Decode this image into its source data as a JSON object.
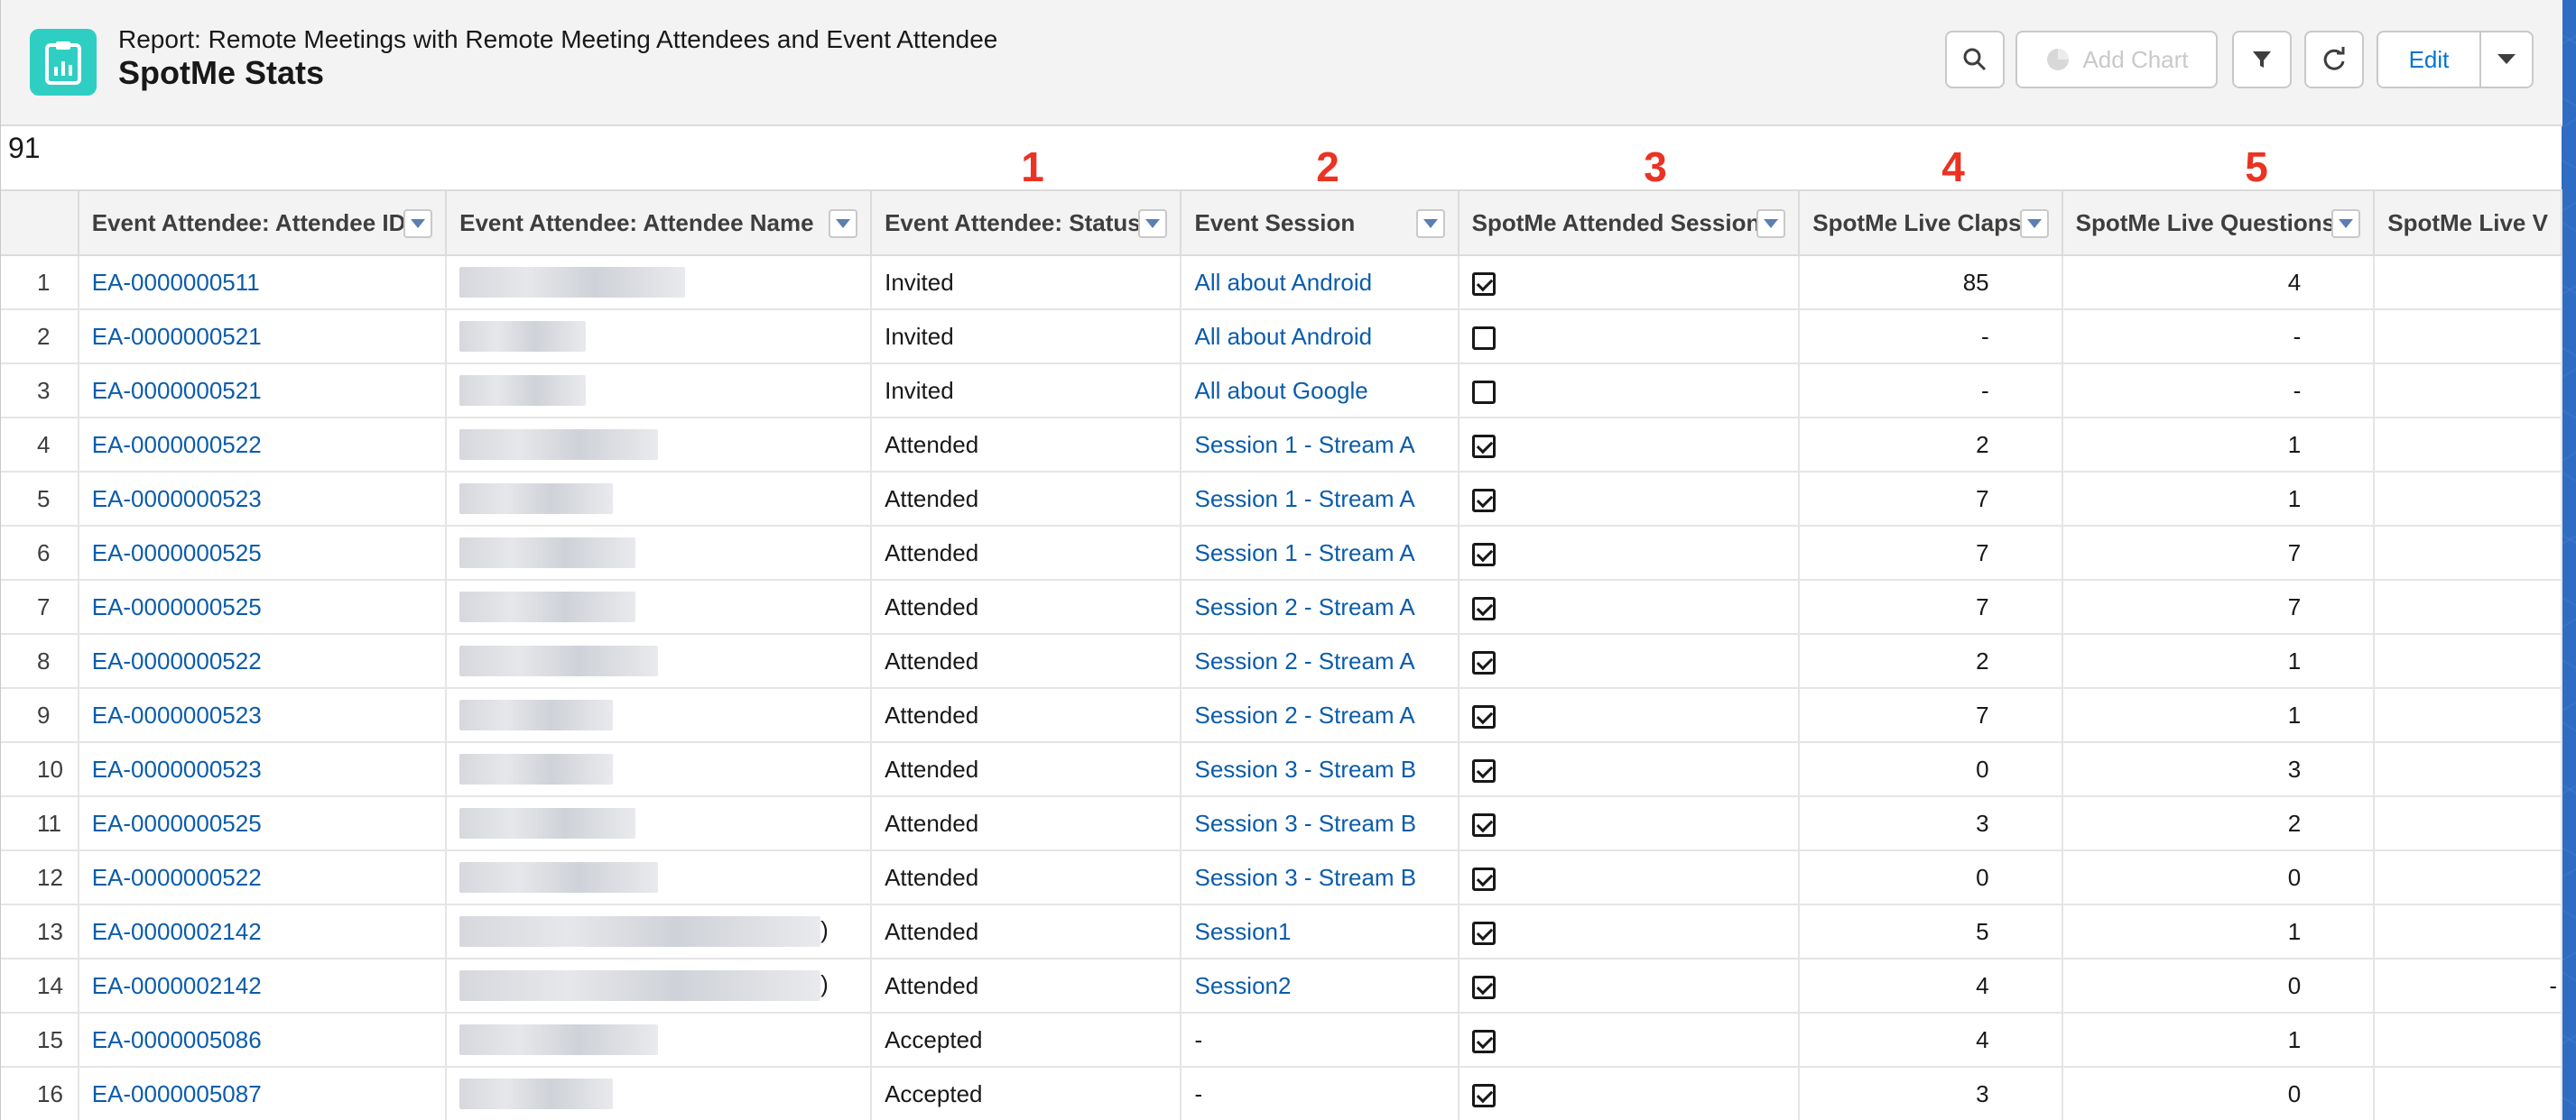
{
  "header": {
    "report_type": "Report: Remote Meetings with Remote Meeting Attendees and Event Attendee",
    "title": "SpotMe Stats",
    "buttons": {
      "search_icon": "search-icon",
      "add_chart": "Add Chart",
      "filter_icon": "filter-icon",
      "refresh_icon": "refresh-icon",
      "edit": "Edit",
      "dropdown_icon": "chevron-down-icon"
    }
  },
  "row_count": "91",
  "markers": [
    "1",
    "2",
    "3",
    "4",
    "5"
  ],
  "columns": [
    "Event Attendee: Attendee ID",
    "Event Attendee: Attendee Name",
    "Event Attendee: Status",
    "Event Session",
    "SpotMe Attended Session",
    "SpotMe Live Claps",
    "SpotMe Live Questions",
    "SpotMe Live V"
  ],
  "rows": [
    {
      "n": "1",
      "id": "EA-0000000511",
      "name_trail": "",
      "status": "Invited",
      "session": "All about Android",
      "attended": true,
      "claps": "85",
      "questions": "4",
      "extra": ""
    },
    {
      "n": "2",
      "id": "EA-0000000521",
      "name_trail": "",
      "status": "Invited",
      "session": "All about Android",
      "attended": false,
      "claps": "-",
      "questions": "-",
      "extra": ""
    },
    {
      "n": "3",
      "id": "EA-0000000521",
      "name_trail": "",
      "status": "Invited",
      "session": "All about Google",
      "attended": false,
      "claps": "-",
      "questions": "-",
      "extra": ""
    },
    {
      "n": "4",
      "id": "EA-0000000522",
      "name_trail": "",
      "status": "Attended",
      "session": "Session 1 - Stream A",
      "attended": true,
      "claps": "2",
      "questions": "1",
      "extra": ""
    },
    {
      "n": "5",
      "id": "EA-0000000523",
      "name_trail": "",
      "status": "Attended",
      "session": "Session 1 - Stream A",
      "attended": true,
      "claps": "7",
      "questions": "1",
      "extra": ""
    },
    {
      "n": "6",
      "id": "EA-0000000525",
      "name_trail": "",
      "status": "Attended",
      "session": "Session 1 - Stream A",
      "attended": true,
      "claps": "7",
      "questions": "7",
      "extra": ""
    },
    {
      "n": "7",
      "id": "EA-0000000525",
      "name_trail": "",
      "status": "Attended",
      "session": "Session 2 - Stream A",
      "attended": true,
      "claps": "7",
      "questions": "7",
      "extra": ""
    },
    {
      "n": "8",
      "id": "EA-0000000522",
      "name_trail": "",
      "status": "Attended",
      "session": "Session 2 - Stream A",
      "attended": true,
      "claps": "2",
      "questions": "1",
      "extra": ""
    },
    {
      "n": "9",
      "id": "EA-0000000523",
      "name_trail": "",
      "status": "Attended",
      "session": "Session 2 - Stream A",
      "attended": true,
      "claps": "7",
      "questions": "1",
      "extra": ""
    },
    {
      "n": "10",
      "id": "EA-0000000523",
      "name_trail": "",
      "status": "Attended",
      "session": "Session 3 - Stream B",
      "attended": true,
      "claps": "0",
      "questions": "3",
      "extra": ""
    },
    {
      "n": "11",
      "id": "EA-0000000525",
      "name_trail": "",
      "status": "Attended",
      "session": "Session 3 - Stream B",
      "attended": true,
      "claps": "3",
      "questions": "2",
      "extra": ""
    },
    {
      "n": "12",
      "id": "EA-0000000522",
      "name_trail": "",
      "status": "Attended",
      "session": "Session 3 - Stream B",
      "attended": true,
      "claps": "0",
      "questions": "0",
      "extra": ""
    },
    {
      "n": "13",
      "id": "EA-0000002142",
      "name_trail": ")",
      "status": "Attended",
      "session": "Session1",
      "attended": true,
      "claps": "5",
      "questions": "1",
      "extra": ""
    },
    {
      "n": "14",
      "id": "EA-0000002142",
      "name_trail": ")",
      "status": "Attended",
      "session": "Session2",
      "attended": true,
      "claps": "4",
      "questions": "0",
      "extra": "-"
    },
    {
      "n": "15",
      "id": "EA-0000005086",
      "name_trail": "",
      "status": "Accepted",
      "session": "-",
      "attended": true,
      "claps": "4",
      "questions": "1",
      "extra": ""
    },
    {
      "n": "16",
      "id": "EA-0000005087",
      "name_trail": "",
      "status": "Accepted",
      "session": "-",
      "attended": true,
      "claps": "3",
      "questions": "0",
      "extra": ""
    }
  ]
}
